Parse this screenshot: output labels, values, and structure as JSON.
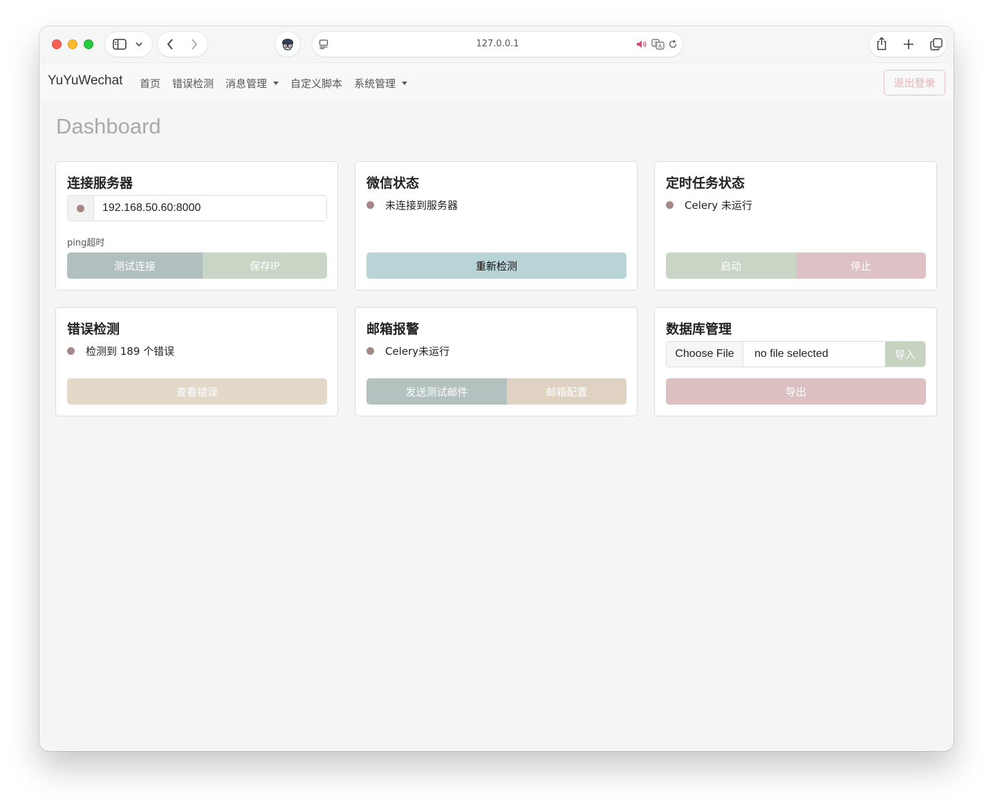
{
  "browser": {
    "url": "127.0.0.1"
  },
  "app": {
    "brand": "YuYuWechat",
    "nav": [
      {
        "label": "首页"
      },
      {
        "label": "错误检测"
      },
      {
        "label": "消息管理"
      },
      {
        "label": "自定义脚本"
      },
      {
        "label": "系统管理"
      }
    ],
    "logout_label": "退出登录"
  },
  "page": {
    "title": "Dashboard"
  },
  "cards": {
    "server": {
      "title": "连接服务器",
      "ip_value": "192.168.50.60:8000",
      "help_text": "ping超时",
      "test_label": "测试连接",
      "save_label": "保存IP"
    },
    "wechat": {
      "title": "微信状态",
      "status": "未连接到服务器",
      "recheck_label": "重新检测"
    },
    "scheduler": {
      "title": "定时任务状态",
      "status": "Celery 未运行",
      "start_label": "启动",
      "stop_label": "停止"
    },
    "errors": {
      "title": "错误检测",
      "status": "检测到 189 个错误",
      "view_label": "查看错误"
    },
    "mail": {
      "title": "邮箱报警",
      "status": "Celery未运行",
      "send_test_label": "发送测试邮件",
      "config_label": "邮箱配置"
    },
    "database": {
      "title": "数据库管理",
      "choose_file_label": "Choose File",
      "file_name": "no file selected",
      "import_label": "导入",
      "export_label": "导出"
    }
  },
  "colors": {
    "status_dot": "#a48887",
    "btn_slate": "#b1c0bf",
    "btn_sage": "#c9d6c6",
    "btn_teal": "#b9d4d6",
    "btn_rose": "#ddc1c4",
    "btn_sand": "#e4d8c9",
    "btn_tan": "#e0d2c2",
    "btn_slate_dark": "#b3c1bf",
    "btn_pink": "#dcc0c2"
  }
}
